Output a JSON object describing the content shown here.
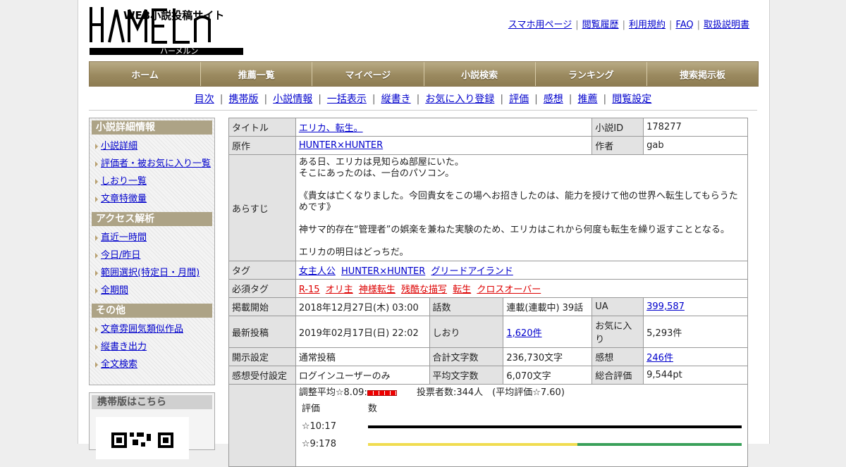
{
  "site": {
    "logo_text": "HAMELN",
    "logo_subtitle": "WEB小説投稿サイト",
    "logo_kana": "ハーメルン"
  },
  "top_links": [
    "スマホ用ページ",
    "閲覧履歴",
    "利用規約",
    "FAQ",
    "取扱説明書"
  ],
  "nav": [
    "ホーム",
    "推薦一覧",
    "マイページ",
    "小説検索",
    "ランキング",
    "捜索掲示板"
  ],
  "subnav": [
    "目次",
    "携帯版",
    "小説情報",
    "一括表示",
    "縦書き",
    "お気に入り登録",
    "評価",
    "感想",
    "推薦",
    "閲覧設定"
  ],
  "sidebar": {
    "sections": [
      {
        "title": "小説詳細情報",
        "items": [
          "小説詳細",
          "評価者・被お気に入り一覧",
          "しおり一覧",
          "文章特徴量"
        ]
      },
      {
        "title": "アクセス解析",
        "items": [
          "直近一時間",
          "今日/昨日",
          "範囲選択(特定日・月間)",
          "全期間"
        ]
      },
      {
        "title": "その他",
        "items": [
          "文章雰囲気類似作品",
          "縦書き出力",
          "全文検索"
        ]
      }
    ],
    "mobile_title": "携帯版はこちら"
  },
  "novel": {
    "labels": {
      "title": "タイトル",
      "id": "小説ID",
      "original": "原作",
      "author": "作者",
      "synopsis": "あらすじ",
      "tags": "タグ",
      "required_tags": "必須タグ",
      "published": "掲載開始",
      "episodes": "話数",
      "ua": "UA",
      "latest": "最新投稿",
      "bookmarks": "しおり",
      "favorites": "お気に入り",
      "disclosure": "開示設定",
      "total_chars": "合計文字数",
      "comments": "感想",
      "comment_setting": "感想受付設定",
      "avg_chars": "平均文字数",
      "total_rating": "総合評価"
    },
    "title": "エリカ、転生。",
    "id": "178277",
    "original": "HUNTER×HUNTER",
    "author": "gab",
    "synopsis": [
      "ある日、エリカは見知らぬ部屋にいた。",
      "そこにあったのは、一台のパソコン。",
      "",
      "《貴女は亡くなりました。今回貴女をこの場へお招きしたのは、能力を授けて他の世界へ転生してもらうためです》",
      "",
      "神サマ的存在“管理者”の娯楽を兼ねた実験のため、エリカはこれから何度も転生を繰り返すこととなる。",
      "",
      "エリカの明日はどっちだ。"
    ],
    "tags": [
      "女主人公",
      "HUNTER×HUNTER",
      "グリードアイランド"
    ],
    "required_tags": [
      "R-15",
      "オリ主",
      "神様転生",
      "残酷な描写",
      "転生",
      "クロスオーバー"
    ],
    "published": "2018年12月27日(木) 03:00",
    "episodes": "連載(連載中) 39話",
    "ua": "399,587",
    "latest": "2019年02月17日(日) 22:02",
    "bookmarks": "1,620件",
    "favorites": "5,293件",
    "disclosure": "通常投稿",
    "total_chars": "236,730文字",
    "comments": "246件",
    "comment_setting": "ログインユーザーのみ",
    "avg_chars": "6,070文字",
    "total_rating": "9,544pt"
  },
  "rating": {
    "adjusted_avg": "調整平均☆8.09:",
    "voters": "投票者数:344人　(平均評価☆7.60)",
    "col_rating": "評価",
    "col_count": "数",
    "rows": [
      {
        "label": "☆10:17",
        "count": 17,
        "colors": [
          "#000000"
        ]
      },
      {
        "label": "☆9:178",
        "count": 178,
        "colors": [
          "#f0dc50",
          "#3aa05a"
        ]
      }
    ]
  },
  "colors": {
    "nav_bg": "#9b8a60",
    "side_head": "#ada386",
    "required_tag": "#dd0000",
    "link": "#0000cc"
  }
}
